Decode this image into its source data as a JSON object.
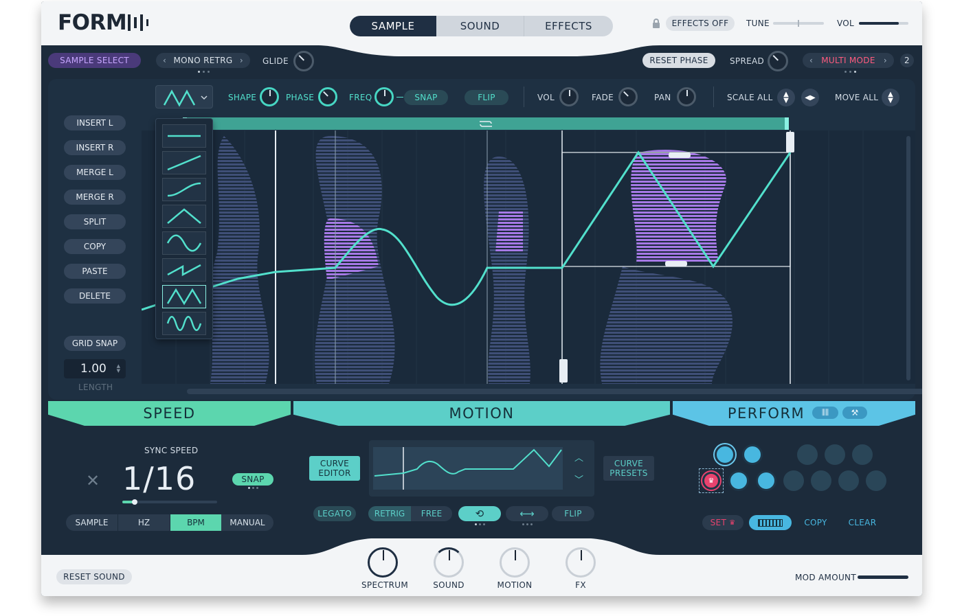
{
  "header": {
    "logo": "FORM",
    "tabs": [
      "SAMPLE",
      "SOUND",
      "EFFECTS"
    ],
    "active_tab": "SAMPLE",
    "effects_off": "EFFECTS OFF",
    "tune_label": "TUNE",
    "vol_label": "VOL",
    "vol_level": 0.8
  },
  "toolbar": {
    "sample_select": "SAMPLE SELECT",
    "mono_retrig": "MONO RETRG",
    "glide": "GLIDE",
    "reset_phase": "RESET PHASE",
    "spread": "SPREAD",
    "multi_mode": "MULTI MODE",
    "multi_mode_count": "2"
  },
  "editor_bar": {
    "shape": "SHAPE",
    "phase": "PHASE",
    "freq": "FREQ",
    "snap": "SNAP",
    "flip": "FLIP",
    "vol": "VOL",
    "fade": "FADE",
    "pan": "PAN",
    "scale_all": "SCALE ALL",
    "move_all": "MOVE ALL"
  },
  "sidebar": {
    "buttons": [
      "INSERT L",
      "INSERT R",
      "MERGE L",
      "MERGE R",
      "SPLIT",
      "COPY",
      "PASTE",
      "DELETE"
    ],
    "grid_snap": "GRID SNAP",
    "length_value": "1.00",
    "length_label": "LENGTH"
  },
  "shape_menu": {
    "items": [
      "flat-line-icon",
      "ramp-up-icon",
      "s-curve-icon",
      "triangle-icon",
      "sine-icon",
      "sawtooth-icon",
      "double-triangle-icon",
      "double-sine-icon"
    ],
    "selected_index": 6
  },
  "sections": {
    "speed": "SPEED",
    "motion": "MOTION",
    "perform": "PERFORM"
  },
  "speed": {
    "sync_label": "SYNC SPEED",
    "value": "1/16",
    "snap": "SNAP",
    "modes": [
      "SAMPLE",
      "HZ",
      "BPM",
      "MANUAL"
    ],
    "active_mode": "BPM"
  },
  "motion": {
    "curve_editor": "CURVE EDITOR",
    "curve_presets": "CURVE PRESETS",
    "legato": "LEGATO",
    "retrig": "RETRIG",
    "free": "FREE",
    "flip": "FLIP"
  },
  "perform": {
    "set": "SET",
    "copy": "COPY",
    "clear": "CLEAR"
  },
  "footer": {
    "reset_sound": "RESET SOUND",
    "macros": [
      "SPECTRUM",
      "SOUND",
      "MOTION",
      "FX"
    ],
    "mod_amount": "MOD AMOUNT"
  },
  "colors": {
    "teal": "#52e0cc",
    "purple": "#b285f0",
    "accent_red": "#e8436e",
    "dark_bg": "#1c2b3b"
  }
}
